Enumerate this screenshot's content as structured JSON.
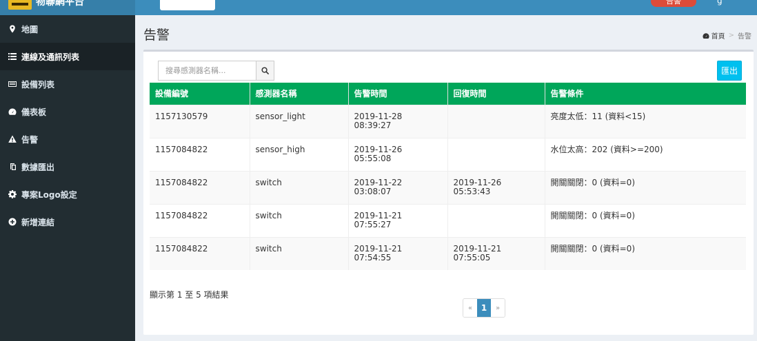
{
  "header": {
    "brand": "物聯網平台",
    "alert_badge": "告警",
    "user": "g"
  },
  "sidebar": {
    "items": [
      {
        "label": "地圖",
        "icon": "map-marker-icon"
      },
      {
        "label": "連線及通訊列表",
        "icon": "list-icon"
      },
      {
        "label": "設備列表",
        "icon": "device-list-icon"
      },
      {
        "label": "儀表板",
        "icon": "dashboard-icon"
      },
      {
        "label": "告警",
        "icon": "warning-icon"
      },
      {
        "label": "數據匯出",
        "icon": "export-icon"
      },
      {
        "label": "專案Logo設定",
        "icon": "gear-icon"
      },
      {
        "label": "新增連結",
        "icon": "plus-circle-icon"
      }
    ],
    "active_index": 1
  },
  "page": {
    "title": "告警",
    "breadcrumb_home": "首頁",
    "breadcrumb_current": "告警"
  },
  "search": {
    "placeholder": "搜尋感測器名稱...",
    "value": ""
  },
  "export_label": "匯出",
  "table": {
    "headers": [
      "設備編號",
      "感測器名稱",
      "告警時間",
      "回復時間",
      "告警條件"
    ],
    "rows": [
      {
        "device": "1157130579",
        "sensor": "sensor_light",
        "alert_date": "2019-11-28",
        "alert_time": "08:39:27",
        "recover_date": "",
        "recover_time": "",
        "condition": "亮度太低：11 (資料<15)"
      },
      {
        "device": "1157084822",
        "sensor": "sensor_high",
        "alert_date": "2019-11-26",
        "alert_time": "05:55:08",
        "recover_date": "",
        "recover_time": "",
        "condition": "水位太高：202 (資料>=200)"
      },
      {
        "device": "1157084822",
        "sensor": "switch",
        "alert_date": "2019-11-22",
        "alert_time": "03:08:07",
        "recover_date": "2019-11-26",
        "recover_time": "05:53:43",
        "condition": "開關關閉：0 (資料=0)"
      },
      {
        "device": "1157084822",
        "sensor": "switch",
        "alert_date": "2019-11-21",
        "alert_time": "07:55:27",
        "recover_date": "",
        "recover_time": "",
        "condition": "開關關閉：0 (資料=0)"
      },
      {
        "device": "1157084822",
        "sensor": "switch",
        "alert_date": "2019-11-21",
        "alert_time": "07:54:55",
        "recover_date": "2019-11-21",
        "recover_time": "07:55:05",
        "condition": "開關關閉：0 (資料=0)"
      }
    ]
  },
  "info_text": "顯示第 1 至 5 項結果",
  "pagination": {
    "prev": "«",
    "current": "1",
    "next": "»"
  },
  "colors": {
    "header_blue": "#3c8dbc",
    "sidebar_dark": "#222d32",
    "table_header_green": "#00a65a",
    "export_cyan": "#00c0ef"
  }
}
